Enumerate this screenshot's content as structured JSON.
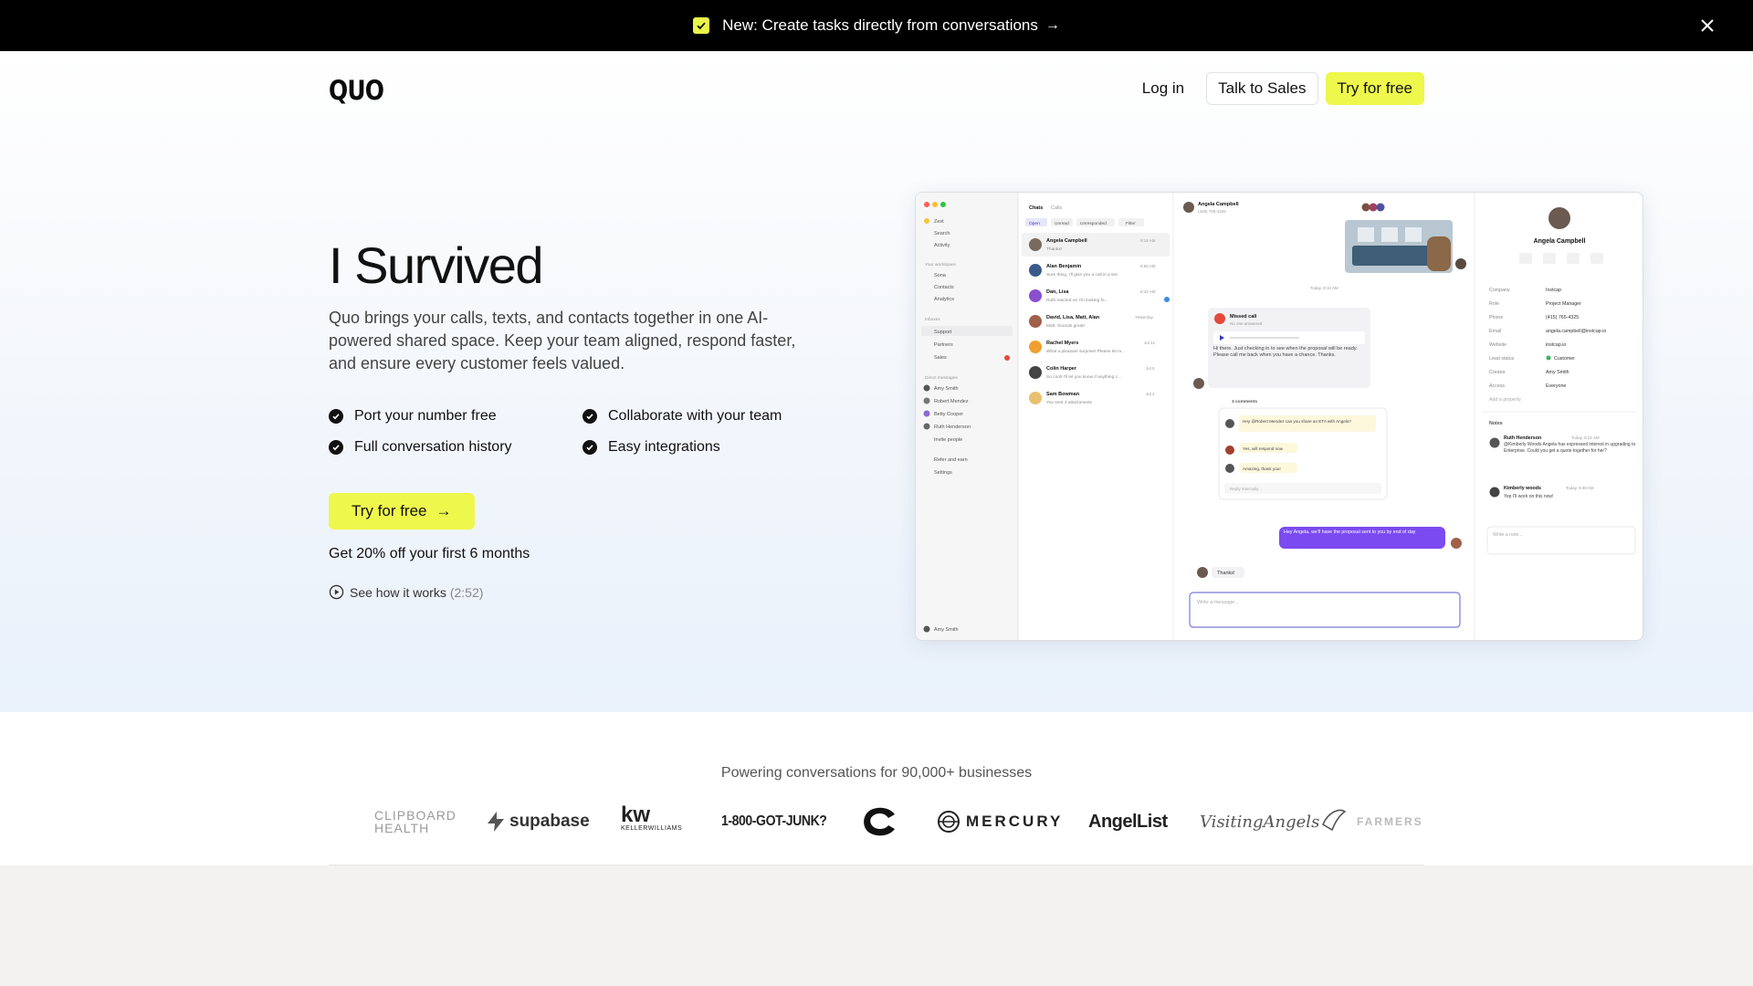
{
  "announcement": {
    "text": "New: Create tasks directly from conversations"
  },
  "nav": {
    "logo": "QUO",
    "login": "Log in",
    "talk_to_sales": "Talk to Sales",
    "try_free": "Try for free"
  },
  "hero": {
    "title": "I Survived",
    "description": "Quo brings your calls, texts, and contacts together in one AI-powered shared space. Keep your team aligned, respond faster, and ensure every customer feels valued.",
    "features": [
      "Port your number free",
      "Collaborate with your team",
      "Full conversation history",
      "Easy integrations"
    ],
    "cta": "Try for free",
    "discount": "Get 20% off your first 6 months",
    "see_how": "See how it works",
    "duration": "(2:52)"
  },
  "preview": {
    "sidebar_items": [
      "Zest",
      "Search",
      "Activity",
      "Your workspace",
      "Sona",
      "Contacts",
      "Analytics",
      "Inboxes",
      "Support",
      "Partners",
      "Sales",
      "Direct messages",
      "Amy Smith",
      "Robert Mendez",
      "Betty Cooper",
      "Ruth Henderson",
      "Invite people",
      "Refer and earn",
      "Settings",
      "Amy Smith"
    ],
    "tabs": [
      "Chats",
      "Calls"
    ],
    "filters": [
      "Open",
      "Unread",
      "Unresponded",
      "Filter"
    ],
    "conversations": [
      {
        "name": "Angela Campbell",
        "preview": "Thanks!",
        "time": "9:14 AM"
      },
      {
        "name": "Alan Benjamin",
        "preview": "Sure thing, I'll give you a call in a sec",
        "time": "8:55 AM"
      },
      {
        "name": "Dan, Lisa",
        "preview": "Ruth reacted on I'm looking fo...",
        "time": "8:42 AM"
      },
      {
        "name": "David, Lisa, Matt, Alan",
        "preview": "Matt: Sounds great!",
        "time": "Yesterday"
      },
      {
        "name": "Rachel Myers",
        "preview": "What a pleasant surprise! Please let m...",
        "time": "Jul 12"
      },
      {
        "name": "Colin Harper",
        "preview": "So cool! I'll let you know if anything c...",
        "time": "Jul 5"
      },
      {
        "name": "Sam Bowman",
        "preview": "You sent 3 attachments",
        "time": "Jul 2"
      }
    ],
    "chat_header_name": "Angela Campbell",
    "chat_header_phone": "(415) 765-4325",
    "day_label": "Today, 9:10 AM",
    "missed_call": "Missed call",
    "missed_call_sub": "No one answered",
    "voicemail": "Hi there. Just checking in to see when the proposal will be ready. Please call me back when you have a chance. Thanks.",
    "thread_label": "3 comments",
    "thread": [
      "Hey @Robert Mendez can you share an ETA with Angela?",
      "Yes, will respond now",
      "Amazing, thank you!"
    ],
    "reply_placeholder": "Reply internally...",
    "outgoing": "Hey Angela, we'll have the proposal sent to you by end of day",
    "incoming_thanks": "Thanks!",
    "composer_placeholder": "Write a message...",
    "contact_name": "Angela Campbell",
    "contact_fields": [
      [
        "Company",
        "Instcap"
      ],
      [
        "Role",
        "Project Manager"
      ],
      [
        "Phone",
        "(415) 765-4325"
      ],
      [
        "Email",
        "angela.campbell@instcap.io"
      ],
      [
        "Website",
        "instcap.io"
      ],
      [
        "Lead status",
        "Customer"
      ],
      [
        "Creator",
        "Amy Smith"
      ],
      [
        "Access",
        "Everyone"
      ]
    ],
    "add_property": "Add a property",
    "notes_label": "Notes",
    "notes": [
      {
        "name": "Ruth Henderson",
        "time": "Today, 9:21 AM",
        "text": "@Kimberly Woods Angela has expressed interest in upgrading to Enterprise. Could you get a quote together for her?"
      },
      {
        "name": "Kimberly woods",
        "time": "Today, 9:46 AM",
        "text": "Yep I'll work on this now!"
      }
    ],
    "note_placeholder": "Write a note..."
  },
  "logos": {
    "heading": "Powering conversations for 90,000+ businesses",
    "items": [
      "CLIPBOARD",
      "HEALTH",
      "supabase",
      "kw",
      "KELLERWILLIAMS",
      "1-800-GOT-JUNK?",
      "MERCURY",
      "AngelList",
      "VisitingAngels",
      "FARMERS"
    ]
  },
  "colors": {
    "accent_yellow": "#eef74c",
    "dark": "#000000",
    "purple": "#7b4af0"
  }
}
